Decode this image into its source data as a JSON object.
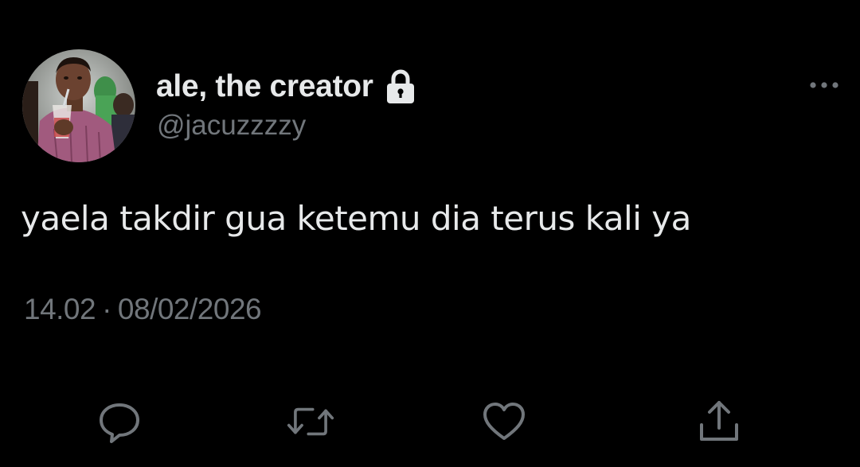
{
  "tweet": {
    "author": {
      "display_name": "ale, the creator",
      "handle": "@jacuzzzzy",
      "protected_icon": "lock-icon",
      "avatar_icon": "avatar-photo"
    },
    "text": "yaela takdir gua ketemu dia terus kali ya",
    "time": "14.02",
    "separator": "·",
    "date": "08/02/2026",
    "more_icon": "more-horizontal-icon",
    "actions": [
      {
        "name": "reply",
        "icon": "reply-icon"
      },
      {
        "name": "retweet",
        "icon": "retweet-icon"
      },
      {
        "name": "like",
        "icon": "heart-icon"
      },
      {
        "name": "share",
        "icon": "share-icon"
      }
    ]
  },
  "colors": {
    "background": "#000000",
    "primary_text": "#e7e9ea",
    "secondary_text": "#71767b"
  }
}
